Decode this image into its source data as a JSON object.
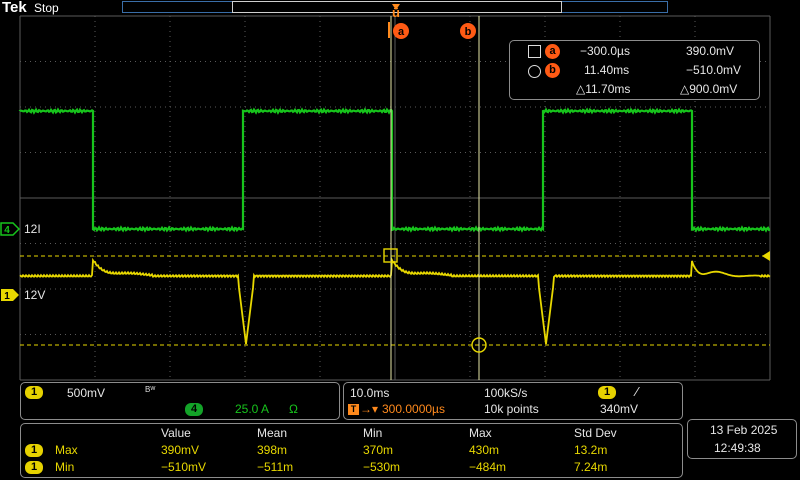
{
  "top": {
    "logo": "Tek",
    "status": "Stop"
  },
  "cursors": {
    "a_label": "a",
    "b_label": "b"
  },
  "cursor_readout": {
    "a_time": "−300.0µs",
    "a_value": "390.0mV",
    "b_time": "11.40ms",
    "b_value": "−510.0mV",
    "delta_time": "△11.70ms",
    "delta_value": "△900.0mV"
  },
  "channels": {
    "ch4": {
      "number": "4",
      "label": "12I",
      "scale": "25.0 A",
      "unit": "Ω",
      "color": "#17c41c"
    },
    "ch1": {
      "number": "1",
      "label": "12V",
      "scale": "500mV",
      "bw": "Bᵂ",
      "color": "#e8d800"
    }
  },
  "horizontal": {
    "timebase": "10.0ms",
    "sample_rate": "100kS/s",
    "trigger_position": "300.0000µs",
    "record_length": "10k points",
    "trigger_channel": "1",
    "trigger_slope": "⁄",
    "trigger_level": "340mV"
  },
  "measurements": {
    "headers": [
      "Value",
      "Mean",
      "Min",
      "Max",
      "Std Dev"
    ],
    "rows": [
      {
        "source": "1",
        "name": "Max",
        "values": [
          "390mV",
          "398m",
          "370m",
          "430m",
          "13.2m"
        ]
      },
      {
        "source": "1",
        "name": "Min",
        "values": [
          "−510mV",
          "−511m",
          "−530m",
          "−484m",
          "7.24m"
        ]
      }
    ]
  },
  "clock": {
    "date": "13 Feb  2025",
    "time": "12:49:38"
  },
  "colors": {
    "grid": "#5a5a5a",
    "ch1": "#e8d800",
    "ch4": "#17c41c",
    "cursor": "#e8e8a8",
    "accent": "#ff8a1d"
  }
}
